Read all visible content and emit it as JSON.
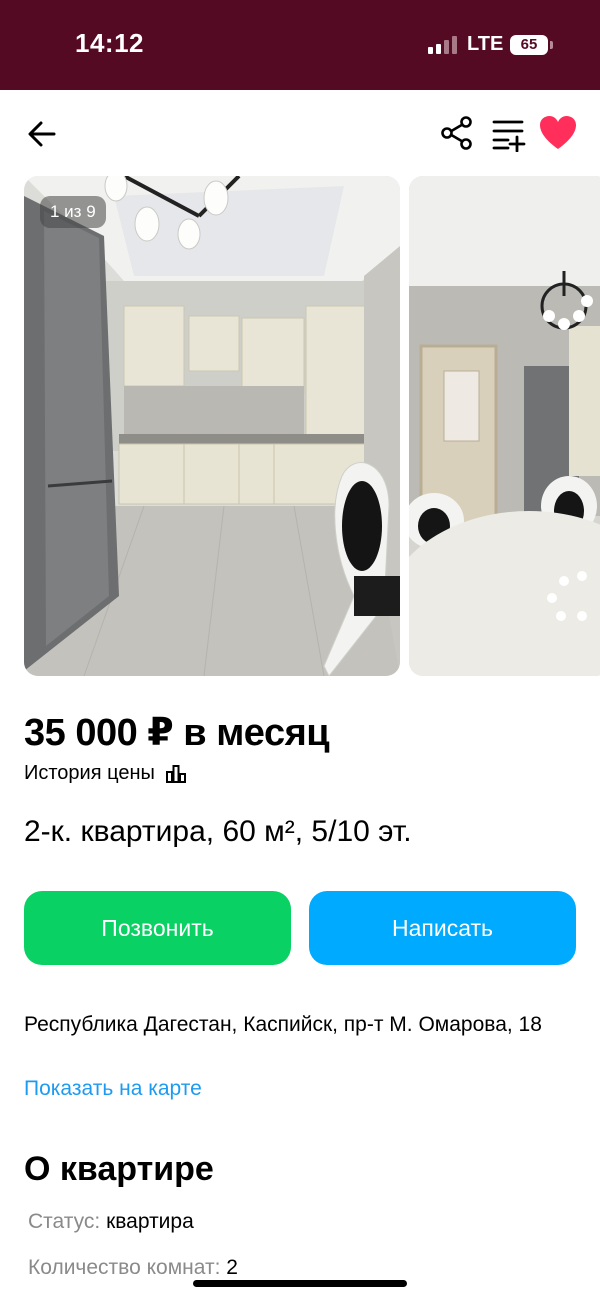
{
  "status_bar": {
    "time": "14:12",
    "network": "LTE",
    "battery": "65"
  },
  "nav": {
    "back_icon": "arrow-left-icon",
    "share_icon": "share-icon",
    "compare_icon": "compare-list-add-icon",
    "favorite_icon": "heart-icon",
    "favorite_color": "#ff2e5a"
  },
  "gallery": {
    "counter": "1 из 9"
  },
  "listing": {
    "price": "35 000 ₽ в месяц",
    "price_history": "История цены",
    "title": "2-к. квартира, 60 м², 5/10 эт."
  },
  "actions": {
    "call": "Позвонить",
    "call_color": "#0ad163",
    "write": "Написать",
    "write_color": "#00aaff"
  },
  "location": {
    "address": "Республика Дагестан, Каспийск, пр-т М. Омарова, 18",
    "map_link": "Показать на карте"
  },
  "about": {
    "title": "О квартире",
    "params": [
      {
        "label": "Статус:",
        "value": "квартира"
      },
      {
        "label": "Количество комнат:",
        "value": "2"
      }
    ]
  }
}
